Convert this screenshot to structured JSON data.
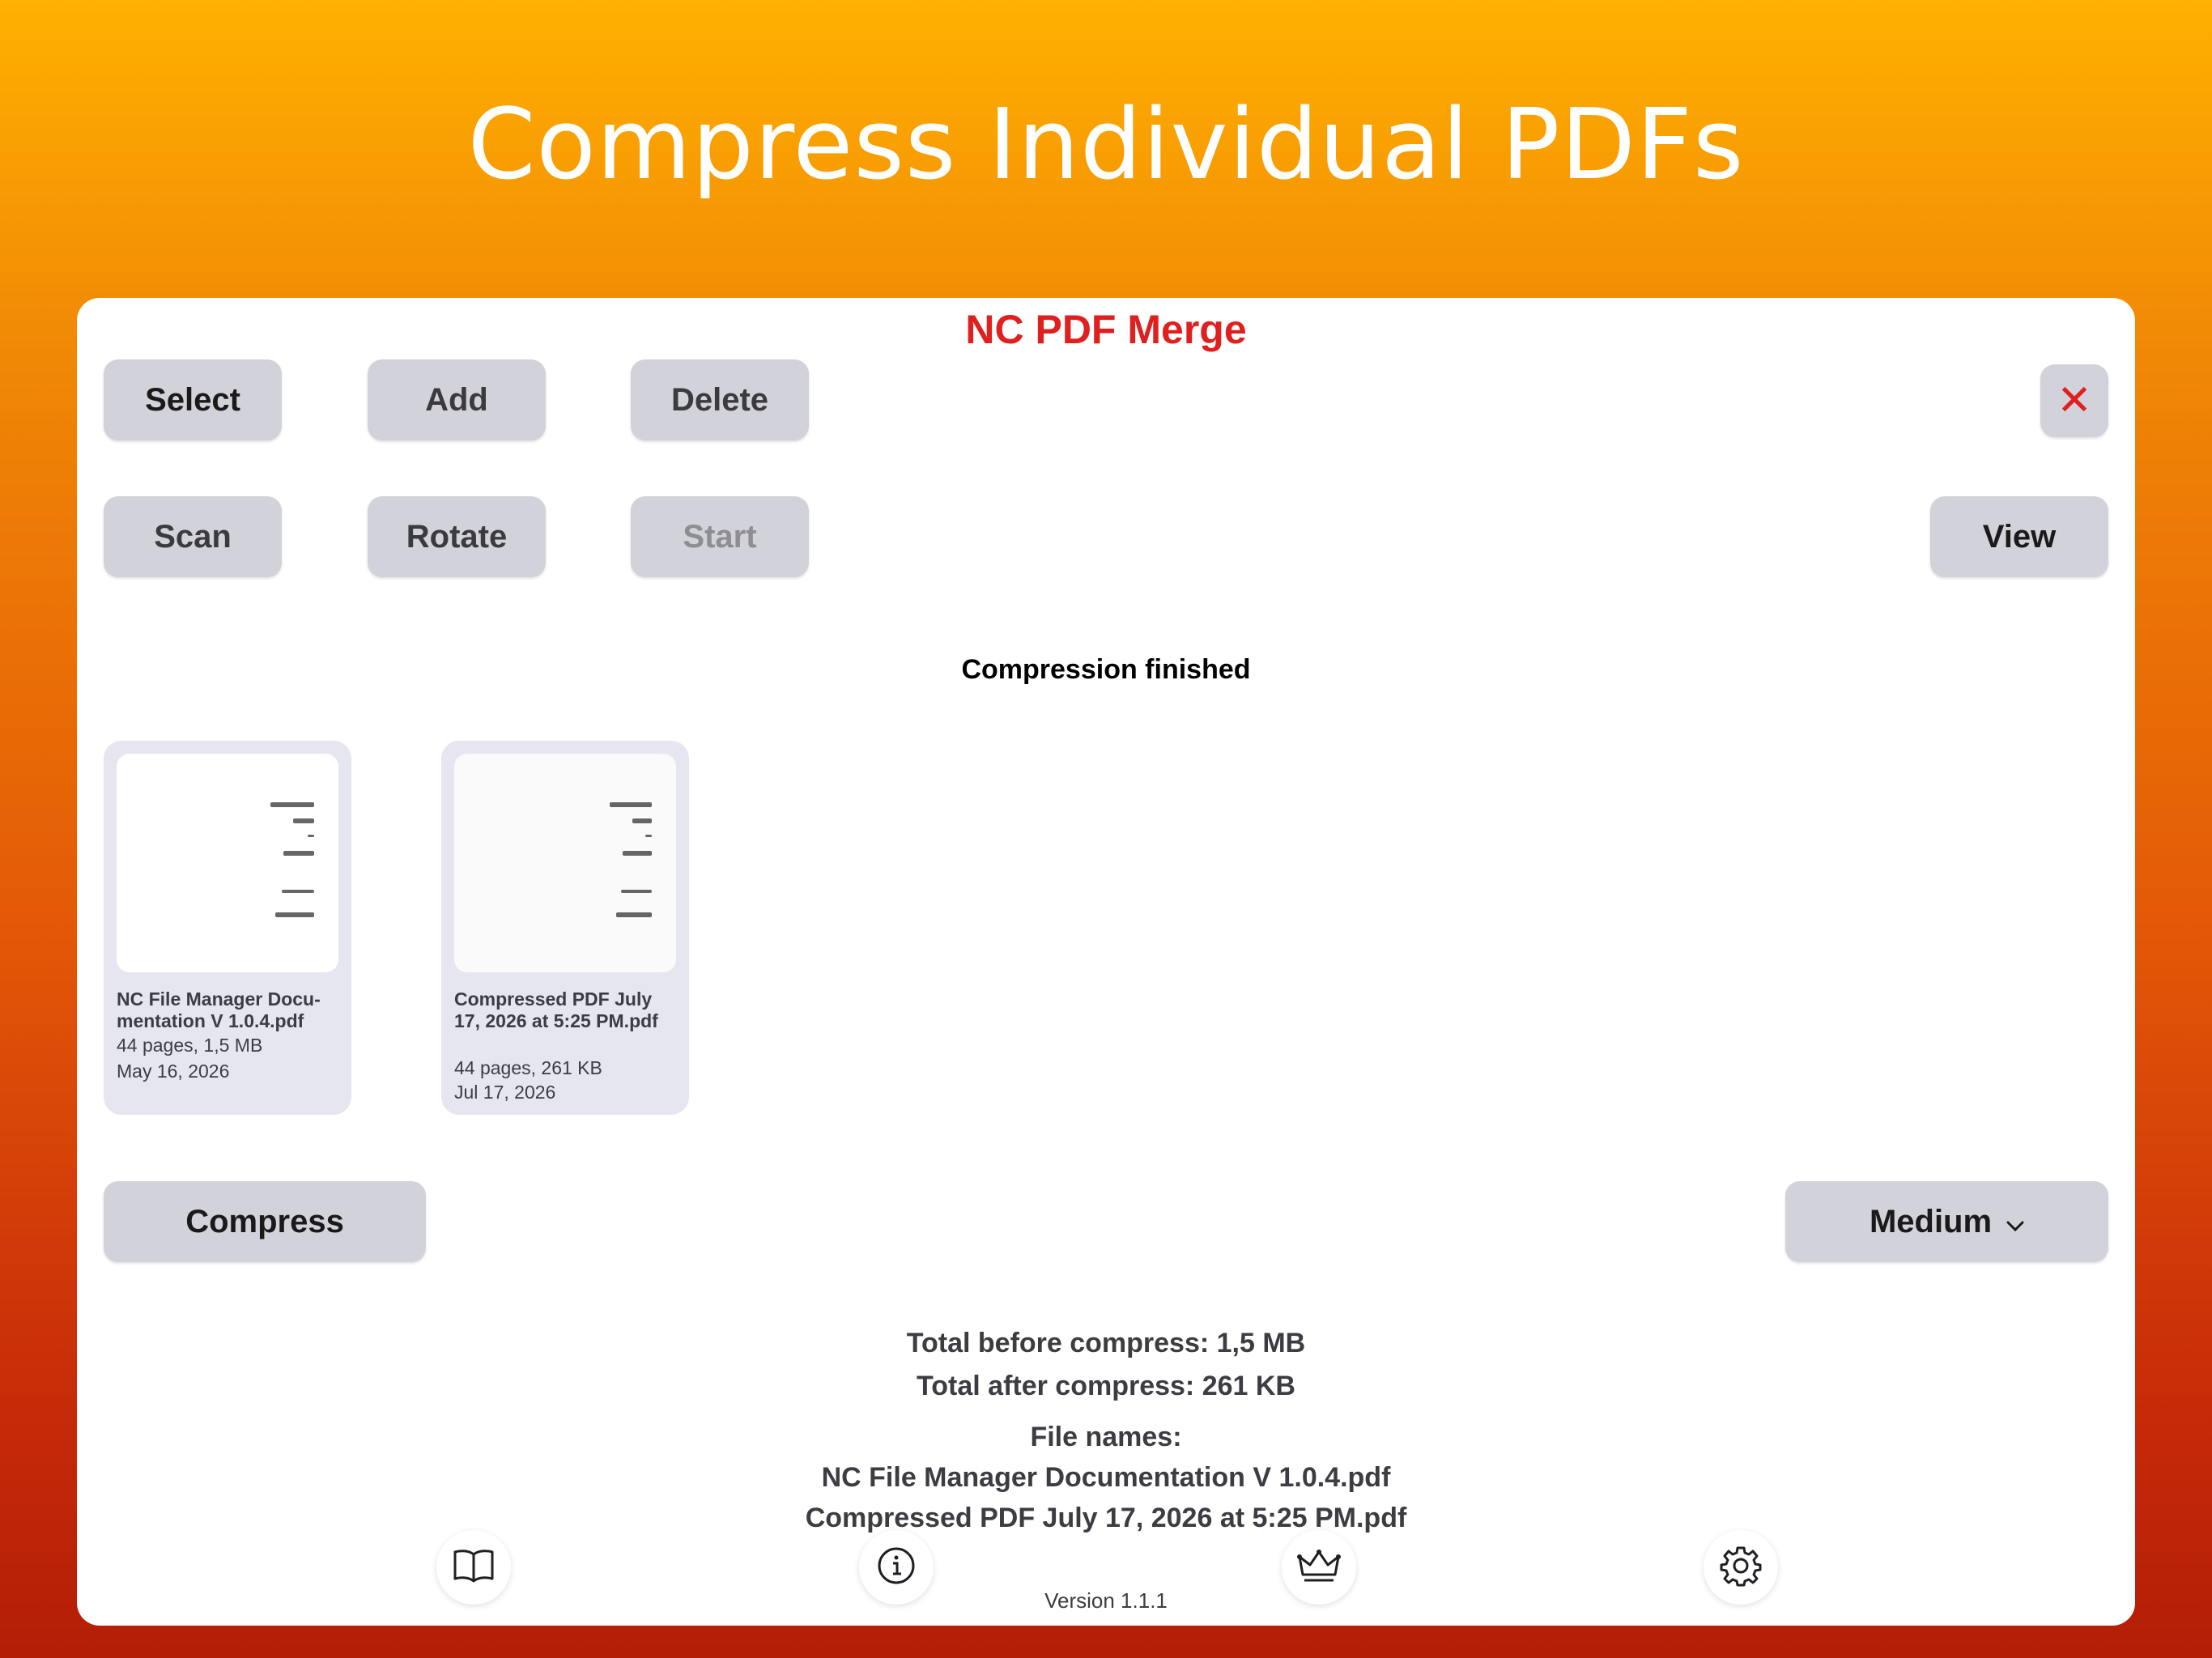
{
  "banner": {
    "title": "Compress Individual PDFs"
  },
  "app": {
    "title": "NC PDF Merge"
  },
  "toolbar": {
    "select": "Select",
    "add": "Add",
    "delete": "Delete",
    "close": "✕",
    "scan": "Scan",
    "rotate": "Rotate",
    "start": "Start",
    "view": "View"
  },
  "status": "Compression finished",
  "files": [
    {
      "name": "NC File Manager Docu-mentation V 1.0.4.pdf",
      "meta1": "44 pages, 1,5 MB",
      "meta2": "May 16, 2026"
    },
    {
      "name": "Compressed PDF July 17, 2026 at 5:25 PM.pdf",
      "meta1": "44 pages, 261 KB",
      "meta2": "Jul 17, 2026"
    }
  ],
  "compress": {
    "button": "Compress",
    "quality": "Medium"
  },
  "summary": {
    "before": "Total before compress:  1,5 MB",
    "after": "Total after compress:  261 KB",
    "names_label": "File names:",
    "name1": "NC File Manager Documentation V 1.0.4.pdf",
    "name2": "Compressed PDF July 17, 2026 at 5:25 PM.pdf"
  },
  "tabs": [
    "book-icon",
    "info-icon",
    "crown-icon",
    "gear-icon"
  ],
  "version": "Version 1.1.1"
}
